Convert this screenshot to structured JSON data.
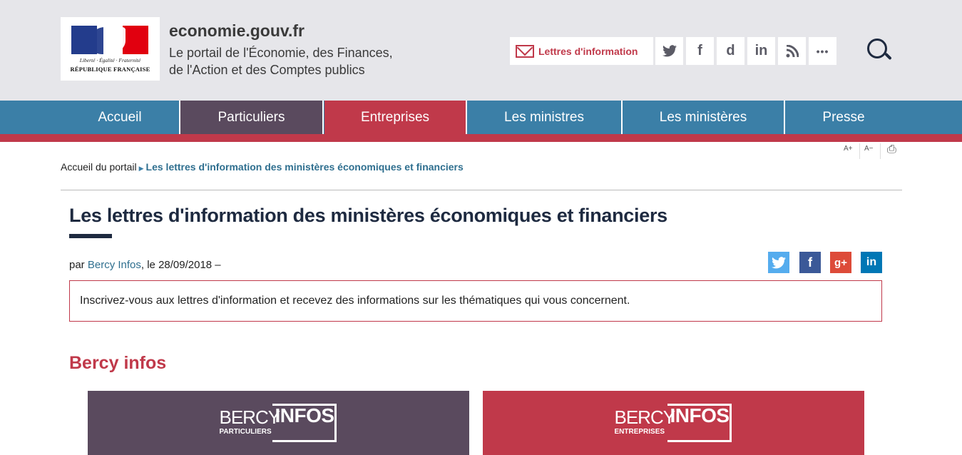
{
  "header": {
    "logo_motto": "Liberté · Égalité · Fraternité",
    "logo_republic": "RÉPUBLIQUE FRANÇAISE",
    "site_name": "economie.gouv.fr",
    "site_desc_line1": "Le portail de l'Économie, des Finances,",
    "site_desc_line2": "de l'Action et des Comptes publics",
    "newsletter_label": "Lettres d'information",
    "social": [
      {
        "name": "twitter-icon",
        "glyph": "🐦"
      },
      {
        "name": "facebook-icon",
        "glyph": "f"
      },
      {
        "name": "dailymotion-icon",
        "glyph": "d"
      },
      {
        "name": "linkedin-icon",
        "glyph": "in"
      },
      {
        "name": "rss-icon",
        "glyph": "◔"
      },
      {
        "name": "more-icon",
        "glyph": "•••"
      }
    ]
  },
  "nav": {
    "items": [
      "Accueil",
      "Particuliers",
      "Entreprises",
      "Les ministres",
      "Les ministères",
      "Presse"
    ],
    "colors": [
      "#3b7fa7",
      "#5a4a5e",
      "#c0394a",
      "#3b7fa7",
      "#3b7fa7",
      "#3b7fa7"
    ]
  },
  "tools": {
    "increase": "A+",
    "decrease": "A−",
    "print": "⎙"
  },
  "breadcrumb": {
    "home": "Accueil du portail",
    "current": "Les lettres d'information des ministères économiques et financiers"
  },
  "article": {
    "title": "Les lettres d'information des ministères économiques et financiers",
    "by_prefix": "par",
    "author": "Bercy Infos",
    "date_text": ", le 28/09/2018 –",
    "intro": "Inscrivez-vous aux lettres d'information et recevez des informations sur les thématiques qui vous concernent.",
    "share": [
      {
        "name": "share-twitter-icon",
        "glyph": "🐦",
        "color": "#55acee"
      },
      {
        "name": "share-facebook-icon",
        "glyph": "f",
        "color": "#3b5998"
      },
      {
        "name": "share-googleplus-icon",
        "glyph": "g+",
        "color": "#dd4b39"
      },
      {
        "name": "share-linkedin-icon",
        "glyph": "in",
        "color": "#0077b5"
      }
    ]
  },
  "section": {
    "title": "Bercy infos",
    "cards": [
      {
        "bercy": "BERCY",
        "infos": "INFOS",
        "sub": "PARTICULIERS",
        "color": "#5a4a5e"
      },
      {
        "bercy": "BERCY",
        "infos": "INFOS",
        "sub": "ENTREPRISES",
        "color": "#c0394a"
      }
    ]
  }
}
